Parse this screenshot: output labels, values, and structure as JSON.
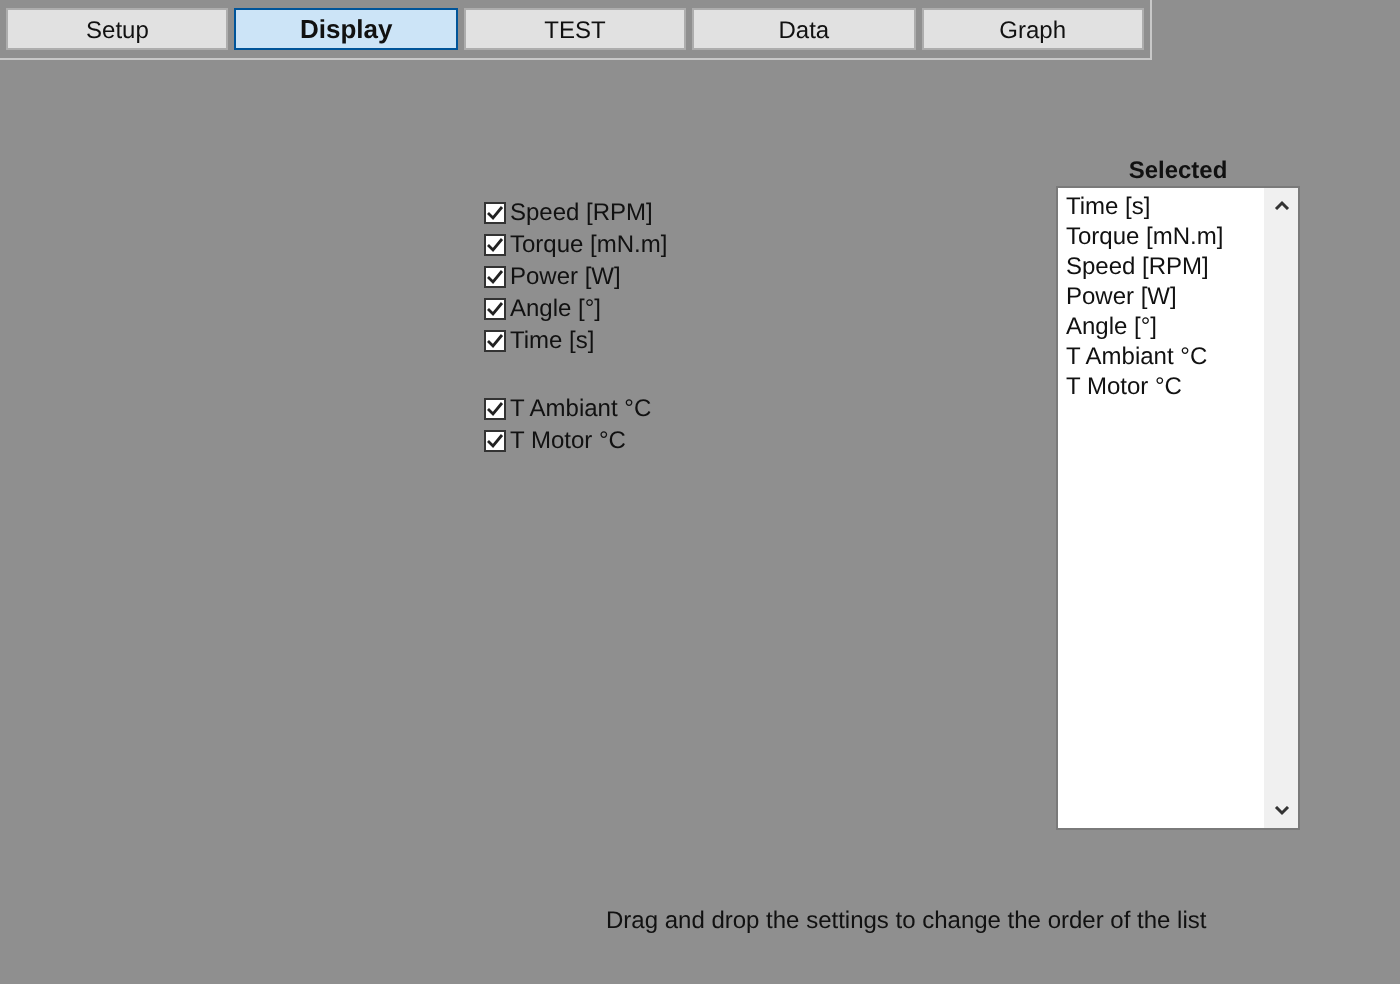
{
  "tabs": [
    {
      "label": "Setup",
      "selected": false
    },
    {
      "label": "Display",
      "selected": true
    },
    {
      "label": "TEST",
      "selected": false
    },
    {
      "label": "Data",
      "selected": false
    },
    {
      "label": "Graph",
      "selected": false
    }
  ],
  "checkbox_groups": [
    [
      {
        "label": "Speed [RPM]",
        "checked": true
      },
      {
        "label": "Torque [mN.m]",
        "checked": true
      },
      {
        "label": "Power [W]",
        "checked": true
      },
      {
        "label": "Angle [°]",
        "checked": true
      },
      {
        "label": "Time [s]",
        "checked": true
      }
    ],
    [
      {
        "label": "T Ambiant °C",
        "checked": true
      },
      {
        "label": "T Motor °C",
        "checked": true
      }
    ]
  ],
  "selected_list": {
    "title": "Selected",
    "items": [
      "Time [s]",
      "Torque [mN.m]",
      "Speed [RPM]",
      "Power [W]",
      "Angle [°]",
      "T Ambiant °C",
      "T Motor °C"
    ]
  },
  "hint": "Drag and drop the settings to change the order of the list"
}
